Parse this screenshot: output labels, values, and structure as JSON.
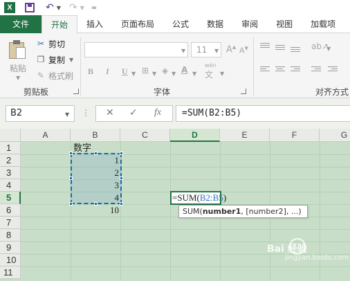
{
  "quick_access": {
    "logo_text": "X",
    "more_symbol": "="
  },
  "tabs": [
    "文件",
    "开始",
    "插入",
    "页面布局",
    "公式",
    "数据",
    "审阅",
    "视图",
    "加载项"
  ],
  "ribbon": {
    "clipboard": {
      "paste_label": "粘贴",
      "cut_label": "剪切",
      "copy_label": "复制",
      "format_painter_label": "格式刷",
      "group_label": "剪贴板"
    },
    "font": {
      "size_value": "11",
      "bold": "B",
      "italic": "I",
      "underline": "U",
      "group_label": "字体",
      "phonetic": "wén"
    },
    "alignment": {
      "group_label": "对齐方式"
    }
  },
  "formula_bar": {
    "name_box": "B2",
    "dots": "⋮",
    "cancel": "✕",
    "enter": "✓",
    "fx": "fx",
    "formula": "=SUM(B2:B5)"
  },
  "grid": {
    "columns": [
      "A",
      "B",
      "C",
      "D",
      "E",
      "F",
      "G"
    ],
    "selected_column": "D",
    "rows": [
      "1",
      "2",
      "3",
      "4",
      "5",
      "6",
      "7",
      "8",
      "9",
      "10",
      "11"
    ],
    "selected_row": "5",
    "cells": {
      "B1": "数字",
      "B2": "1",
      "B3": "2",
      "B4": "3",
      "B5": "4",
      "B6": "10"
    },
    "edit_cell": {
      "prefix": "=SUM(",
      "range": "B2:B5",
      "suffix": ")"
    },
    "tooltip": {
      "fn": "SUM(",
      "arg1": "number1",
      "rest": ", [number2], ...)"
    }
  },
  "watermark": {
    "text": "Bai 经验",
    "url": "jingyan.baidu.com"
  }
}
